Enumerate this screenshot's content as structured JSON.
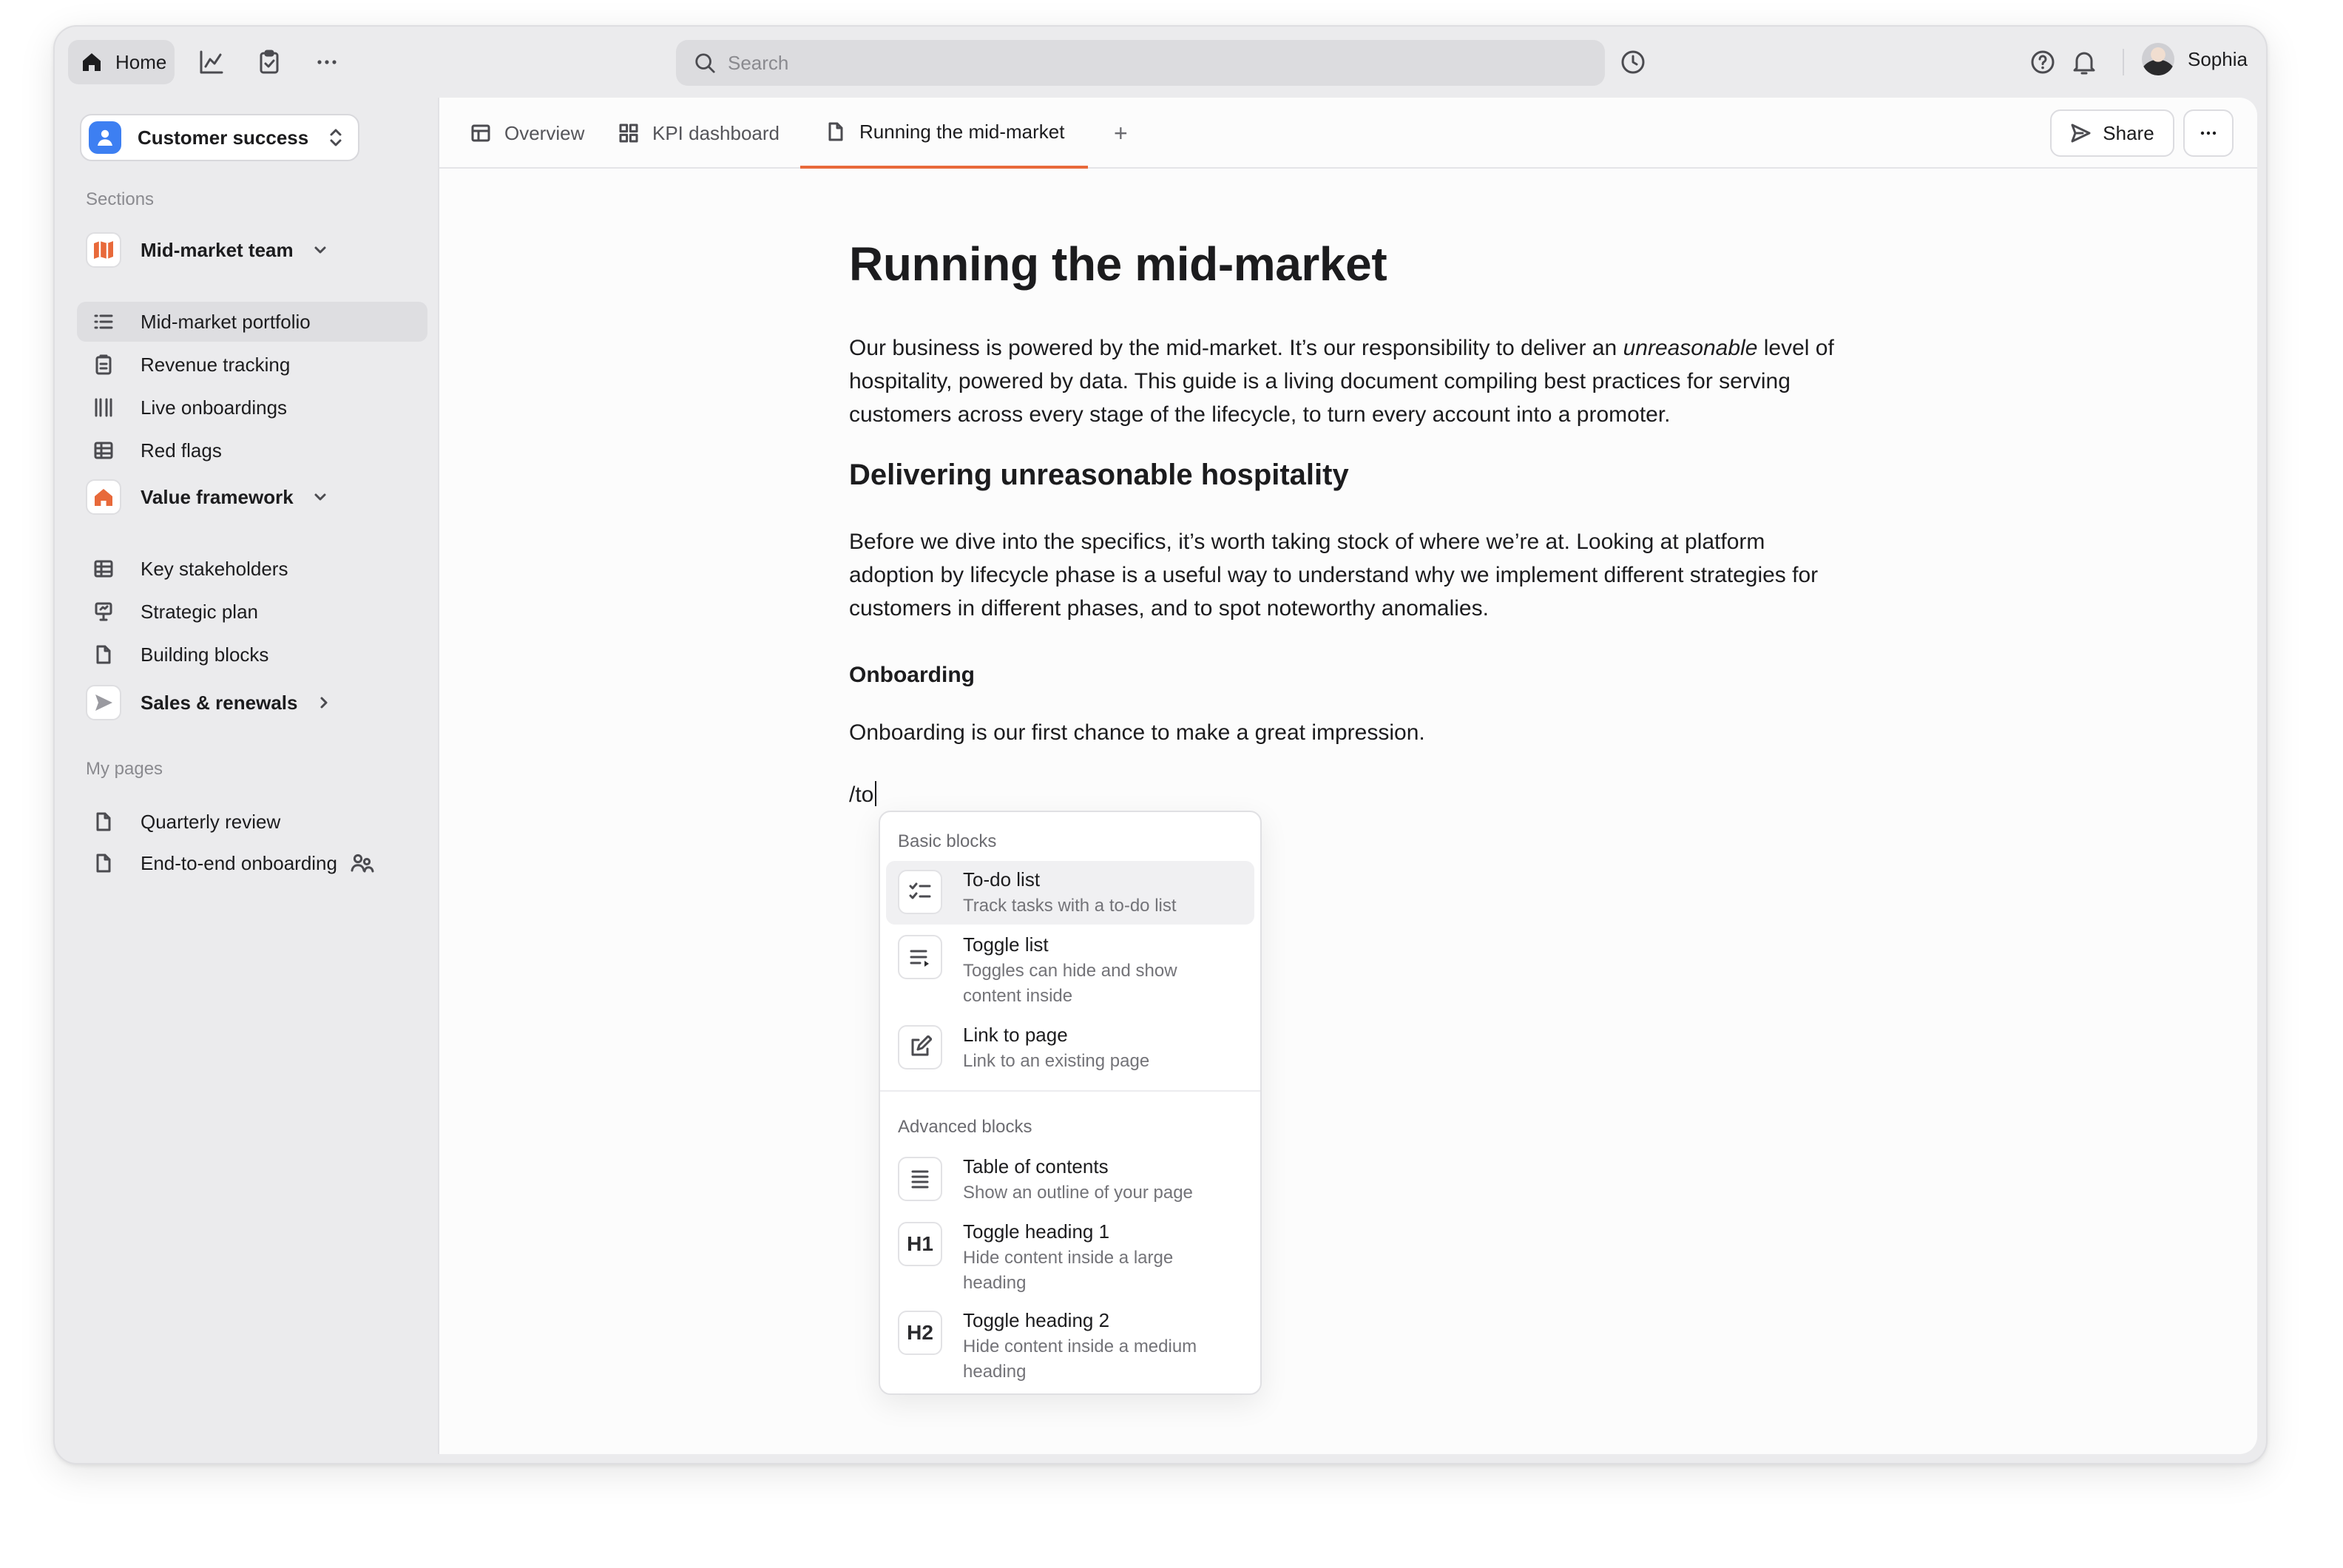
{
  "topbar": {
    "home_label": "Home",
    "search_placeholder": "Search",
    "user_name": "Sophia"
  },
  "sidebar": {
    "workspace": "Customer success",
    "sections_label": "Sections",
    "groups": [
      {
        "label": "Mid-market team",
        "items": [
          "Mid-market portfolio",
          "Revenue tracking",
          "Live onboardings",
          "Red flags"
        ]
      },
      {
        "label": "Value framework",
        "items": [
          "Key stakeholders",
          "Strategic plan",
          "Building blocks"
        ]
      },
      {
        "label": "Sales & renewals",
        "items": []
      }
    ],
    "my_pages_label": "My pages",
    "my_pages": [
      "Quarterly review",
      "End-to-end onboarding"
    ],
    "active_item": "Mid-market portfolio"
  },
  "tabs": {
    "items": [
      "Overview",
      "KPI dashboard",
      "Running the mid-market"
    ],
    "active": "Running the mid-market",
    "share_label": "Share"
  },
  "doc": {
    "title": "Running the mid-market",
    "intro_before": "Our business is powered by the mid-market. It’s our responsibility to deliver an ",
    "intro_em": "unreasonable",
    "intro_after": " level of hospitality, powered by data. This guide is a living document compiling best practices for serving customers across every stage of the lifecycle, to turn every account into a promoter.",
    "h2": "Delivering unreasonable hospitality",
    "para2": "Before we dive into the specifics, it’s worth taking stock of where we’re at. Looking at platform adoption by lifecycle phase is a useful way to understand why we implement different strategies for customers in different phases, and to spot noteworthy anomalies.",
    "h3": "Onboarding",
    "para3": "Onboarding is our first chance to make a great impression.",
    "slash_input": "/to"
  },
  "popup": {
    "basic_label": "Basic blocks",
    "advanced_label": "Advanced blocks",
    "basic": [
      {
        "title": "To-do list",
        "desc": "Track tasks with a to-do list",
        "icon": "checklist-icon"
      },
      {
        "title": "Toggle list",
        "desc": "Toggles can hide and show content inside",
        "icon": "toggle-list-icon"
      },
      {
        "title": "Link to page",
        "desc": "Link to an existing page",
        "icon": "link-page-icon"
      }
    ],
    "advanced": [
      {
        "title": "Table of contents",
        "desc": "Show an outline of your page",
        "icon": "toc-icon"
      },
      {
        "title": "Toggle heading 1",
        "desc": "Hide content inside a large heading",
        "icon": "H1"
      },
      {
        "title": "Toggle heading 2",
        "desc": "Hide content inside a medium heading",
        "icon": "H2"
      }
    ]
  },
  "colors": {
    "accent": "#e8693a",
    "workspace_icon": "#3d7ff2"
  }
}
